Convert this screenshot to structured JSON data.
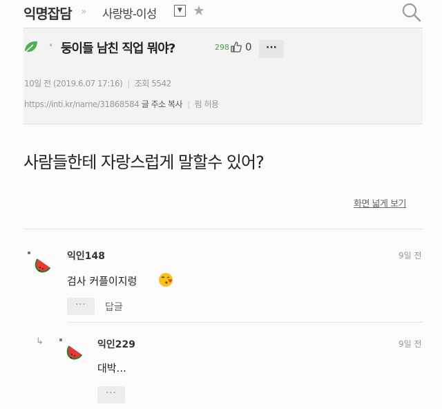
{
  "header": {
    "board": "익명잡담",
    "separator": "»",
    "category": "사랑방-이성",
    "dropdown_glyph": "▼",
    "star_glyph": "★",
    "search_icon": "search-icon"
  },
  "post": {
    "leaf_icon": "leaf-icon",
    "dot": "•",
    "title": "둥이들 남친 직업 뭐야?",
    "likes_count": "298",
    "thumb_glyph": "👍",
    "like_value": "0",
    "more_label": "···",
    "meta": {
      "age": "10일 전 (2019.6.07 17:16)",
      "views": "조회 5542"
    },
    "url": "https://inti.kr/name/31868584",
    "copy_label": "글 주소 복사",
    "policy": "펌 허용",
    "body": "사람들한테 자랑스럽게 말할수 있어?",
    "wide_view": "화면 넓게 보기"
  },
  "comments": [
    {
      "author": "익인148",
      "time": "9일 전",
      "text": "검사 커플이지렁",
      "more_label": "···",
      "reply_label": "답글"
    },
    {
      "arrow": "↳",
      "author": "익인229",
      "time": "9일 전",
      "text": "대박...",
      "more_label": "···"
    }
  ],
  "colors": {
    "accent_green": "#43a047",
    "leaf": "#4caf50",
    "watermelon_red": "#e53935",
    "watermelon_rind": "#2e7d32"
  }
}
